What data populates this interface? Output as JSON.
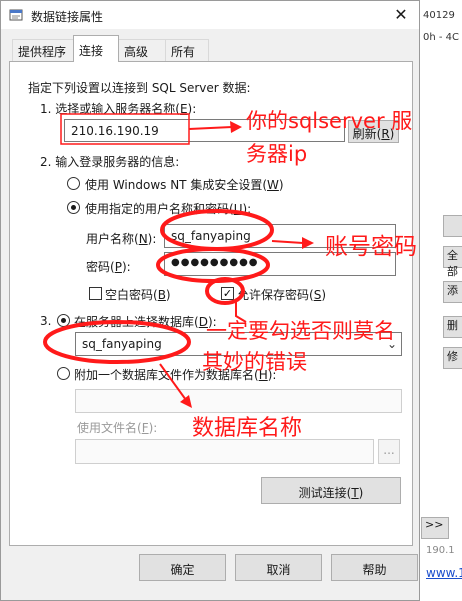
{
  "background": {
    "line1": "40129",
    "line2": "0h - 4C",
    "btn_full": "全部",
    "btn_add": "添",
    "btn_delete": "删",
    "btn_modify": "修",
    "btn_next": ">>",
    "footer_text": "190.1",
    "link": "www.1"
  },
  "dialog": {
    "title": "数据链接属性",
    "close_glyph": "✕",
    "tabs": [
      {
        "label": "提供程序",
        "active": false
      },
      {
        "label": "连接",
        "active": true
      },
      {
        "label": "高级",
        "active": false
      },
      {
        "label": "所有",
        "active": false
      }
    ],
    "intro": "指定下列设置以连接到 SQL Server 数据:",
    "step1": {
      "label_pre": "1. 选择或输入服务器名称(",
      "label_key": "E",
      "label_post": "):",
      "server_value": "210.16.190.19",
      "refresh_pre": "刷新(",
      "refresh_key": "R",
      "refresh_post": ")"
    },
    "step2": {
      "label": "2. 输入登录服务器的信息:",
      "opt_windows_pre": "使用 Windows NT 集成安全设置(",
      "opt_windows_key": "W",
      "opt_windows_post": ")",
      "opt_sql_pre": "使用指定的用户名称和密码(",
      "opt_sql_key": "U",
      "opt_sql_post": "):",
      "username_pre": "用户名称(",
      "username_key": "N",
      "username_post": "):",
      "username_value": "sq_fanyaping",
      "password_pre": "密码(",
      "password_key": "P",
      "password_post": "):",
      "password_value": "●●●●●●●●●",
      "blank_pwd_pre": "空白密码(",
      "blank_pwd_key": "B",
      "blank_pwd_post": ")",
      "save_pwd_pre": "允许保存密码(",
      "save_pwd_key": "S",
      "save_pwd_post": ")",
      "blank_pwd_checked": false,
      "save_pwd_checked": true
    },
    "step3": {
      "num": "3.",
      "opt_select_pre": "在服务器上选择数据库(",
      "opt_select_key": "D",
      "opt_select_post": "):",
      "database_value": "sq_fanyaping",
      "opt_attach_pre": "附加一个数据库文件作为数据库名(",
      "opt_attach_key": "H",
      "opt_attach_post": "):",
      "use_filename_pre": "使用文件名(",
      "use_filename_key": "F",
      "use_filename_post": "):",
      "browse": "..."
    },
    "test_pre": "测试连接(",
    "test_key": "T",
    "test_post": ")",
    "ok": "确定",
    "cancel": "取消",
    "help": "帮助"
  },
  "annotations": {
    "server": "你的sqlserver 服",
    "server2": "务器ip",
    "account": "账号密码",
    "checkbox1": "一定要勾选否则莫名",
    "checkbox2": "其妙的错误",
    "database": "数据库名称",
    "color": "#ff1a1a"
  }
}
